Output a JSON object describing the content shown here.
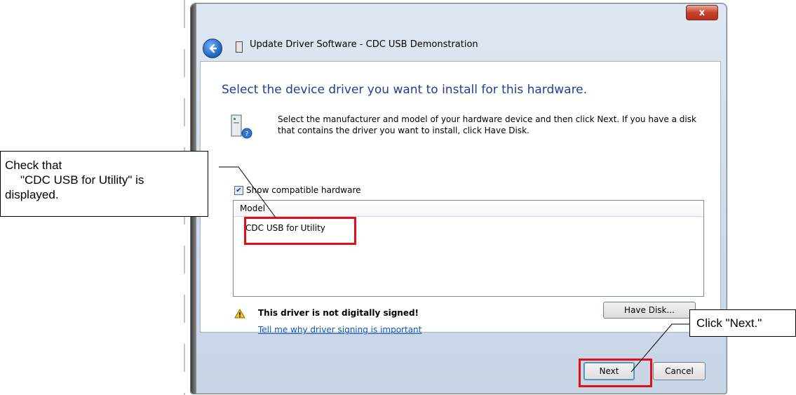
{
  "window": {
    "title": "Update Driver Software - CDC USB Demonstration",
    "close_label": "x"
  },
  "content": {
    "heading": "Select the device driver you want to install for this hardware.",
    "description": "Select the manufacturer and model of your hardware device and then click Next. If you have a disk that contains the driver you want to install, click Have Disk.",
    "show_compatible_label": "Show compatible hardware",
    "show_compatible_checked": true,
    "model_column_header": "Model",
    "models": [
      "CDC USB for Utility"
    ],
    "warning_text": "This driver is not digitally signed!",
    "help_link": "Tell me why driver signing is important",
    "have_disk_label": "Have Disk..."
  },
  "footer": {
    "next_label": "Next",
    "cancel_label": "Cancel"
  },
  "annotations": {
    "check_line1": "Check that",
    "check_line2": "\"CDC USB for Utility\" is",
    "check_line3": "displayed.",
    "click_next": "Click \"Next.\"",
    "highlight_color": "#e0101b"
  },
  "colors": {
    "heading": "#1c3f9c",
    "link": "#0a55c8"
  }
}
